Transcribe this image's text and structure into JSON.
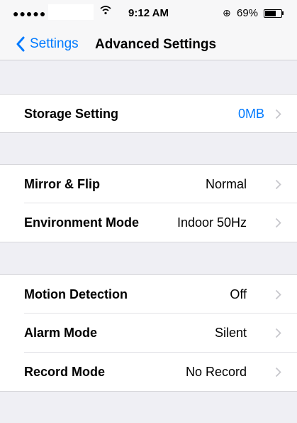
{
  "status_bar": {
    "signal": "●●●●●",
    "time": "9:12 AM",
    "lock_glyph": "⊕",
    "battery_percent": "69%",
    "battery_level": 0.69
  },
  "nav": {
    "back_label": "Settings",
    "title": "Advanced Settings"
  },
  "rows": [
    {
      "label": "Storage Setting",
      "value": "0MB"
    },
    {
      "label": "Mirror & Flip",
      "value": "Normal"
    },
    {
      "label": "Environment Mode",
      "value": "Indoor 50Hz"
    },
    {
      "label": "Motion Detection",
      "value": "Off"
    },
    {
      "label": "Alarm Mode",
      "value": "Silent"
    },
    {
      "label": "Record Mode",
      "value": "No Record"
    }
  ],
  "colors": {
    "accent": "#007aff",
    "background": "#efeff4",
    "chevron": "#c7c7cc"
  },
  "icons": {
    "back": "chevron-left-icon",
    "disclosure": "chevron-right-icon",
    "wifi": "wifi-icon",
    "orientation_lock": "orientation-lock-icon",
    "battery": "battery-icon"
  }
}
